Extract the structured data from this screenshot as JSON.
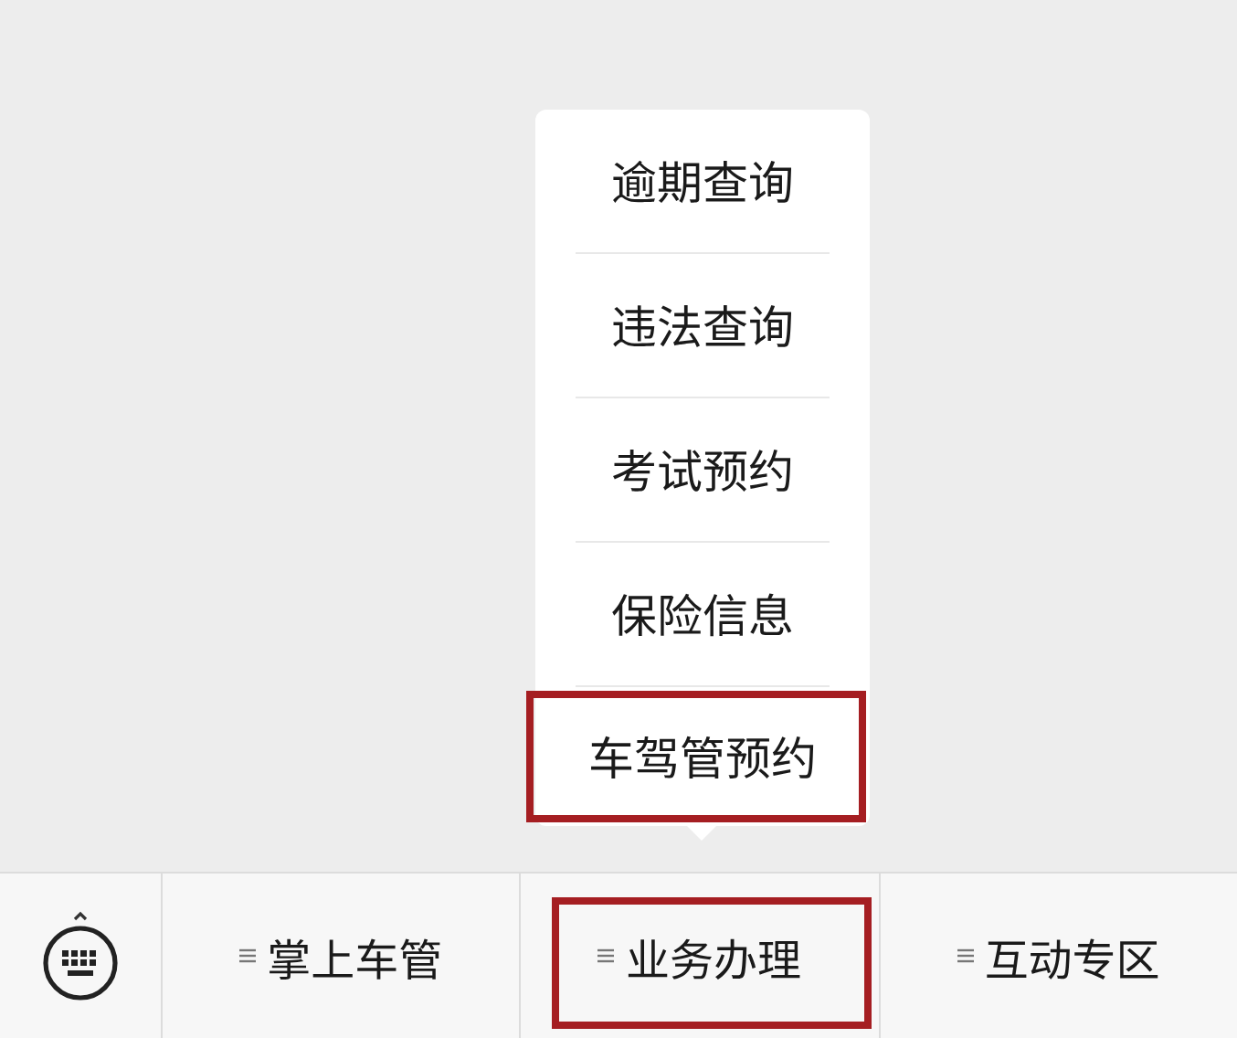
{
  "popup_menu": {
    "items": [
      {
        "label": "逾期查询",
        "highlighted": false
      },
      {
        "label": "违法查询",
        "highlighted": false
      },
      {
        "label": "考试预约",
        "highlighted": false
      },
      {
        "label": "保险信息",
        "highlighted": false
      },
      {
        "label": "车驾管预约",
        "highlighted": true
      }
    ]
  },
  "bottom_menu": {
    "items": [
      {
        "label": "掌上车管",
        "highlighted": false
      },
      {
        "label": "业务办理",
        "highlighted": true
      },
      {
        "label": "互动专区",
        "highlighted": false
      }
    ]
  }
}
